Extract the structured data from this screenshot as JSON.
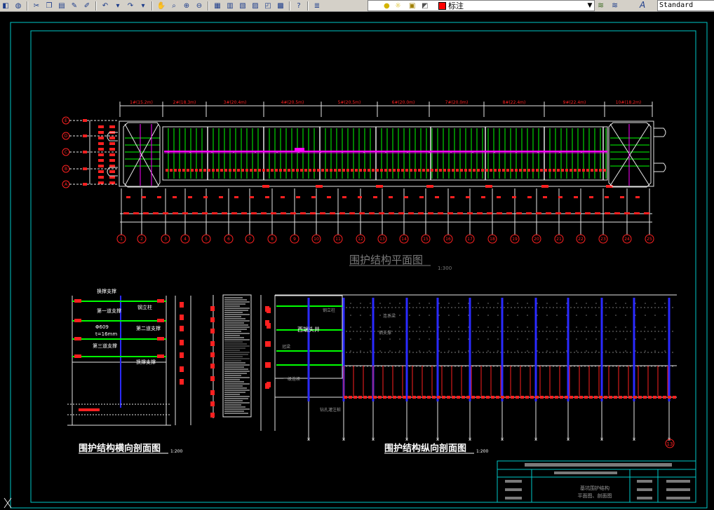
{
  "toolbar": {
    "layer_name": "标注",
    "text_style": "Standard"
  },
  "drawing": {
    "plan_title": "围护结构平面图",
    "plan_scale": "1:300",
    "cross_title": "围护结构横向剖面图",
    "cross_scale": "1:200",
    "long_title": "围护结构纵向剖面图",
    "long_scale": "1:200",
    "segments": [
      "1#(15.2m)",
      "2#(18.3m)",
      "3#(20.4m)",
      "4#(20.5m)",
      "5#(20.5m)",
      "6#(20.0m)",
      "7#(20.0m)",
      "8#(22.4m)",
      "9#(22.4m)",
      "10#(18.2m)"
    ],
    "axis_numbers": [
      "1",
      "2",
      "3",
      "4",
      "5",
      "6",
      "7",
      "8",
      "9",
      "10",
      "11",
      "12",
      "13",
      "14",
      "15",
      "16",
      "17",
      "18",
      "19",
      "20",
      "21",
      "22",
      "23",
      "24",
      "25"
    ],
    "axis_letters": [
      "E",
      "D",
      "C",
      "B",
      "A"
    ],
    "cross_labels": [
      "第一道支撑",
      "第二道支撑",
      "第三道支撑",
      "钢立柱",
      "换撑支撑",
      "Φ609",
      "t=16mm"
    ],
    "long_labels": [
      "钢立柱",
      "西端头井",
      "连系梁",
      "钢支撑",
      "冠梁",
      "一级连续",
      "钻孔灌注桩"
    ],
    "long_marker": "13",
    "title_block": [
      "基坑围护结构",
      "平面图、剖面图"
    ],
    "colors": {
      "frame": "#00c8c8",
      "green": "#00ff00",
      "red": "#ff2020",
      "yellow": "#ffff00",
      "blue": "#2a2aff",
      "magenta": "#ff00ff",
      "white": "#e6e6e6",
      "grey": "#7a7a7a"
    }
  }
}
